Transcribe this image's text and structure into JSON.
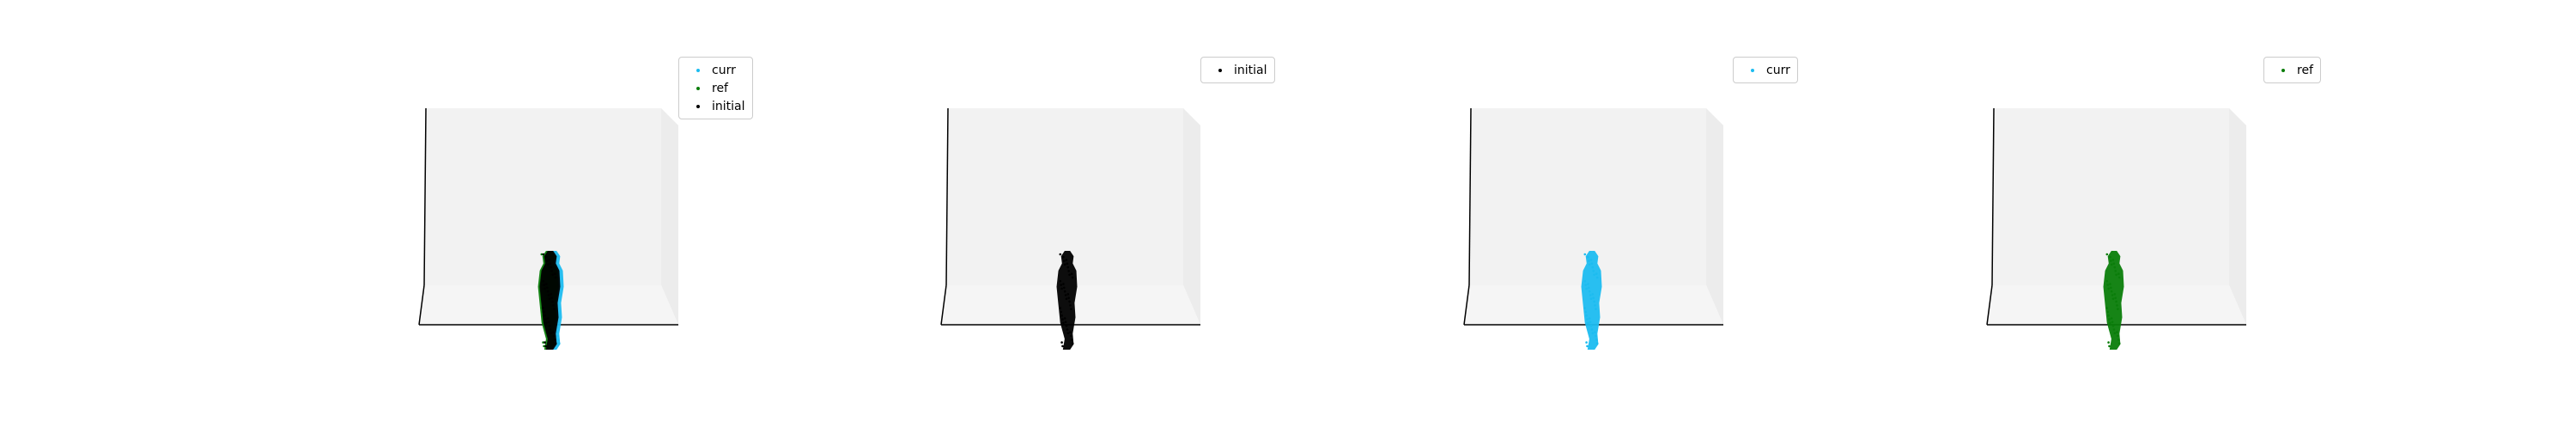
{
  "chart_data": [
    {
      "type": "scatter",
      "projection": "3d",
      "title": "",
      "legend_position": "upper-right",
      "grid": false,
      "series": [
        {
          "name": "curr",
          "color": "#1cbcf0",
          "figure": "standing-person"
        },
        {
          "name": "ref",
          "color": "#0a7d0a",
          "figure": "standing-person"
        },
        {
          "name": "initial",
          "color": "#000000",
          "figure": "standing-person"
        }
      ]
    },
    {
      "type": "scatter",
      "projection": "3d",
      "title": "",
      "legend_position": "upper-right",
      "grid": false,
      "series": [
        {
          "name": "initial",
          "color": "#000000",
          "figure": "standing-person"
        }
      ]
    },
    {
      "type": "scatter",
      "projection": "3d",
      "title": "",
      "legend_position": "upper-right",
      "grid": false,
      "series": [
        {
          "name": "curr",
          "color": "#1cbcf0",
          "figure": "standing-person"
        }
      ]
    },
    {
      "type": "scatter",
      "projection": "3d",
      "title": "",
      "legend_position": "upper-right",
      "grid": false,
      "series": [
        {
          "name": "ref",
          "color": "#0a7d0a",
          "figure": "standing-person"
        }
      ]
    }
  ],
  "colors": {
    "pane_back": "#f2f2f2",
    "pane_side": "#ececec",
    "pane_floor": "#f5f5f5",
    "axis_line": "#000000"
  }
}
